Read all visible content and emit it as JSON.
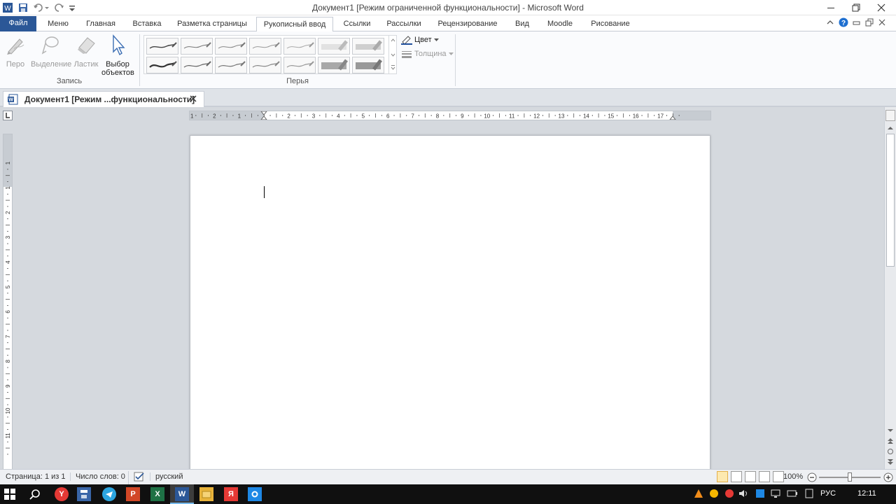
{
  "window": {
    "title": "Документ1 [Режим ограниченной функциональности]  -  Microsoft Word"
  },
  "ribbon_tabs": [
    "Файл",
    "Меню",
    "Главная",
    "Вставка",
    "Разметка страницы",
    "Рукописный ввод",
    "Ссылки",
    "Рассылки",
    "Рецензирование",
    "Вид",
    "Moodle",
    "Рисование"
  ],
  "active_tab": "Рукописный ввод",
  "ribbon": {
    "record_group": {
      "label": "Запись",
      "buttons": [
        "Перо",
        "Выделение",
        "Ластик",
        "Выбор объектов"
      ]
    },
    "pens_group": {
      "label": "Перья",
      "color_label": "Цвет",
      "thickness_label": "Толщина"
    }
  },
  "document_tab": {
    "title": "Документ1 [Режим ...функциональности]"
  },
  "ruler": {
    "h_marks": [
      "1",
      "2",
      "1",
      "1",
      "2",
      "3",
      "4",
      "5",
      "6",
      "7",
      "8",
      "9",
      "10",
      "11",
      "12",
      "13",
      "14",
      "15",
      "16",
      "17"
    ],
    "v_marks": [
      "1",
      "1",
      "2",
      "3",
      "4",
      "5",
      "6",
      "7",
      "8",
      "9",
      "10",
      "11"
    ]
  },
  "status": {
    "page": "Страница: 1 из 1",
    "words": "Число слов: 0",
    "language": "русский",
    "zoom": "100%"
  },
  "taskbar": {
    "lang": "РУС",
    "time": "12:11",
    "app_letters": [
      "Y",
      "P",
      "X",
      "W",
      "Я"
    ]
  },
  "colors": {
    "file_tab": "#2b5797",
    "ink_blue": "#1f4e9b",
    "taskbar": "#101010"
  }
}
